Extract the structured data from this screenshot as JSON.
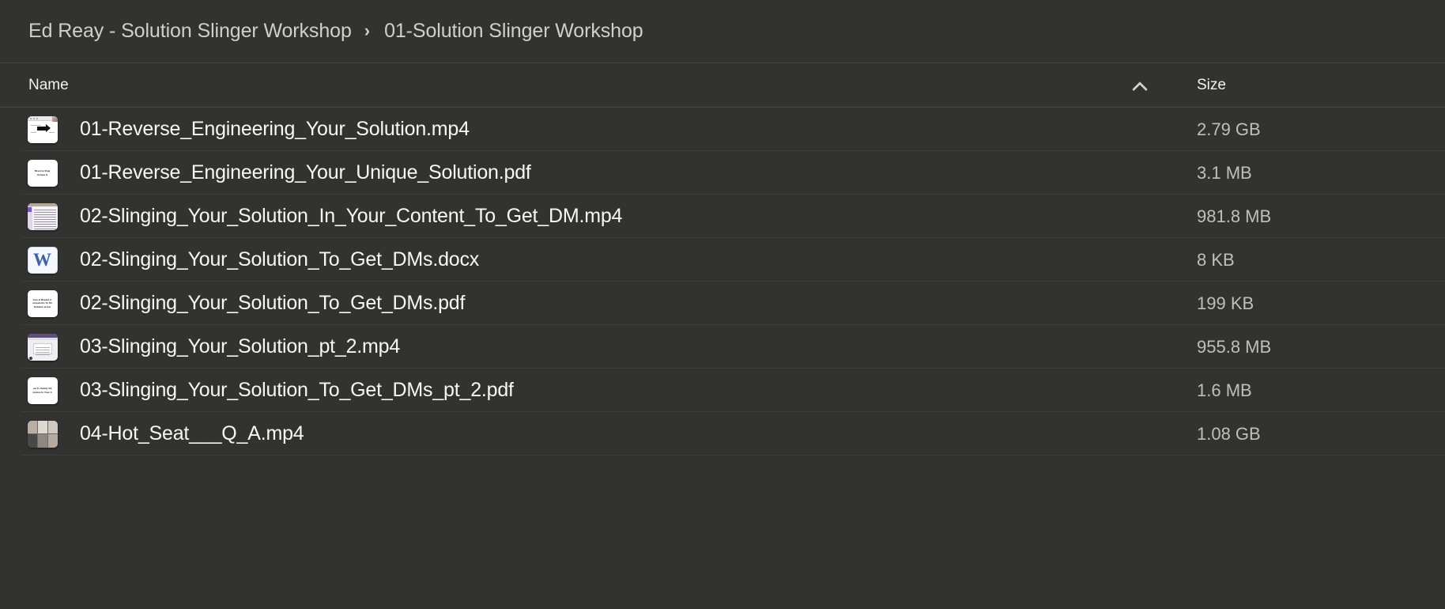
{
  "breadcrumb": {
    "separator": "›",
    "items": [
      {
        "label": "Ed Reay - Solution Slinger Workshop"
      },
      {
        "label": "01-Solution Slinger Workshop"
      }
    ]
  },
  "columns": {
    "name_label": "Name",
    "size_label": "Size",
    "sort_icon": "chevron-up-icon",
    "sort_column": "Name",
    "sort_direction": "ascending"
  },
  "colors": {
    "background": "#323230",
    "row_divider": "#3d3d3a",
    "text_primary": "#f7f7f5",
    "text_secondary": "#bfbfbb",
    "breadcrumb_text": "#cfcfcb",
    "docx_blue": "#3a62ad"
  },
  "files": [
    {
      "name": "01-Reverse_Engineering_Your_Solution.mp4",
      "size": "2.79 GB",
      "icon": "video-thumbnail-icon",
      "kind": "video-slide",
      "thumb_text": []
    },
    {
      "name": "01-Reverse_Engineering_Your_Unique_Solution.pdf",
      "size": "3.1 MB",
      "icon": "pdf-thumbnail-icon",
      "kind": "pdf-page",
      "thumb_text": [
        "Reverse Engi",
        "Unique S"
      ]
    },
    {
      "name": "02-Slinging_Your_Solution_In_Your_Content_To_Get_DM.mp4",
      "size": "981.8 MB",
      "icon": "video-thumbnail-icon",
      "kind": "screen-doc",
      "thumb_text": []
    },
    {
      "name": "02-Slinging_Your_Solution_To_Get_DMs.docx",
      "size": "8 KB",
      "icon": "word-document-icon",
      "kind": "docx-w",
      "thumb_text": [
        "W"
      ]
    },
    {
      "name": "02-Slinging_Your_Solution_To_Get_DMs.pdf",
      "size": "199 KB",
      "icon": "pdf-thumbnail-icon",
      "kind": "pdf-page",
      "thumb_text": [
        "inse & Repeat C",
        "ameworks To Sli",
        "Solution & Get"
      ]
    },
    {
      "name": "03-Slinging_Your_Solution_pt_2.mp4",
      "size": "955.8 MB",
      "icon": "video-thumbnail-icon",
      "kind": "screen-slide",
      "thumb_text": []
    },
    {
      "name": "03-Slinging_Your_Solution_To_Get_DMs_pt_2.pdf",
      "size": "1.6 MB",
      "icon": "pdf-thumbnail-icon",
      "kind": "pdf-page",
      "thumb_text": [
        "ow To Subtly Sli",
        "olution In Your C"
      ]
    },
    {
      "name": "04-Hot_Seat___Q_A.mp4",
      "size": "1.08 GB",
      "icon": "video-thumbnail-icon",
      "kind": "photo-grid",
      "thumb_text": []
    }
  ]
}
